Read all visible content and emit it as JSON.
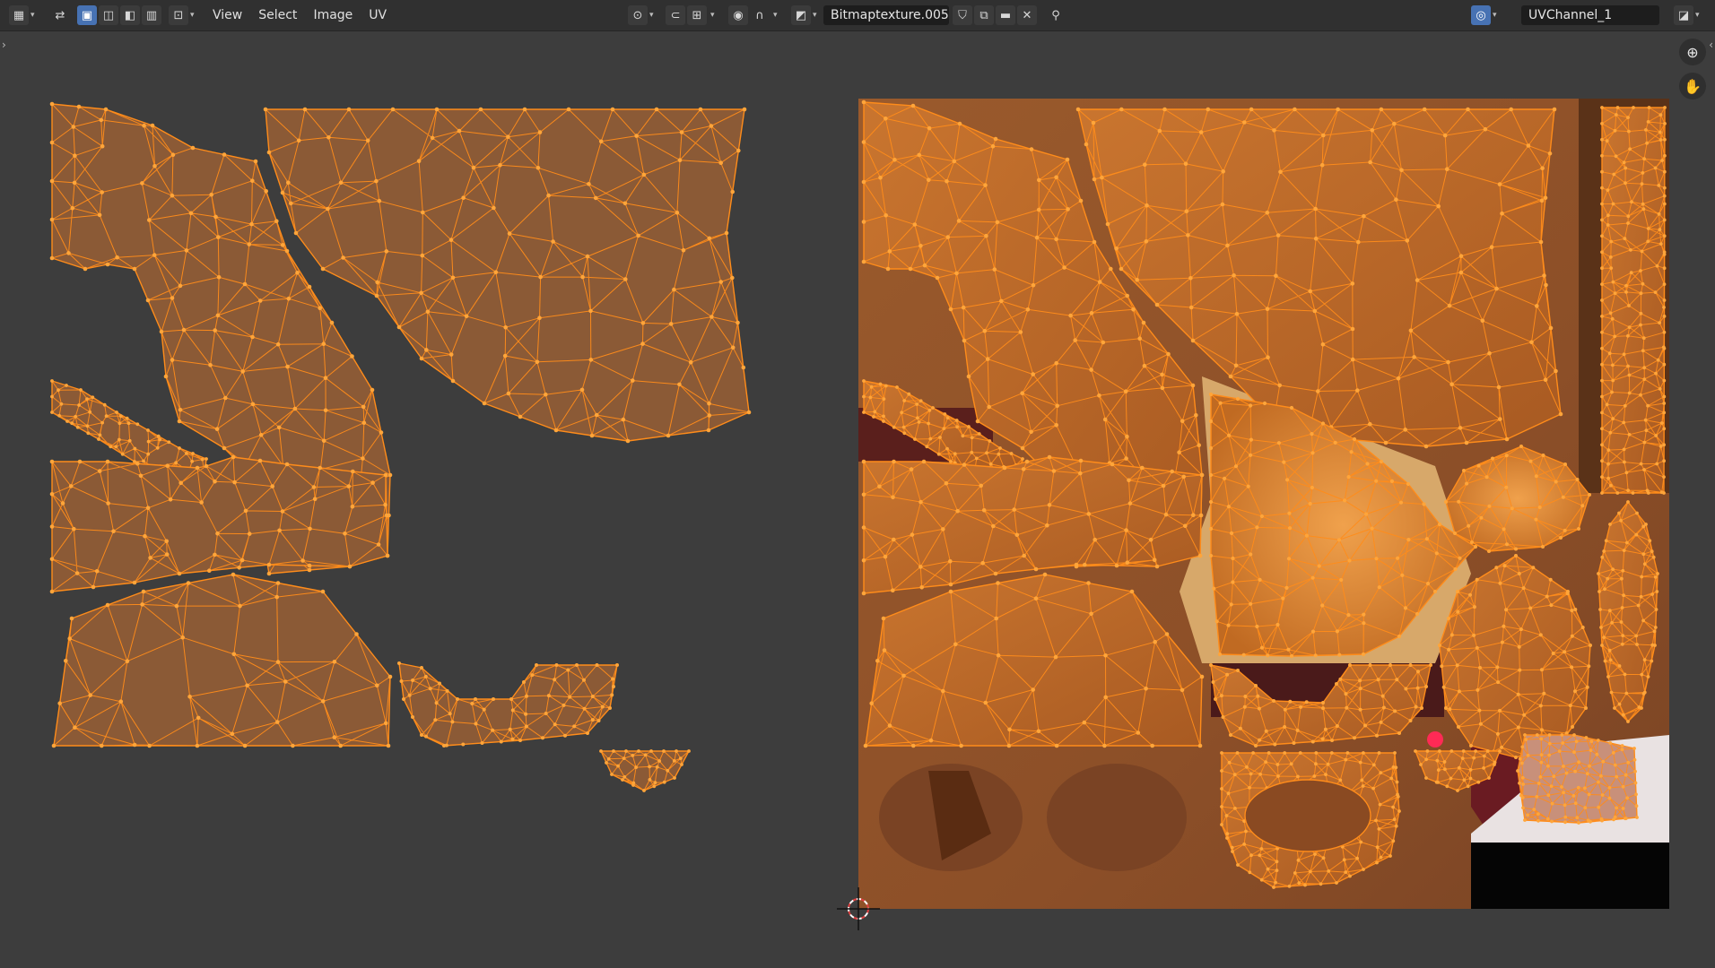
{
  "header": {
    "menus": [
      "View",
      "Select",
      "Image",
      "UV"
    ],
    "image_name": "Bitmaptexture.005",
    "uv_map": "UVChannel_1",
    "icons": [
      "editor-type-icon",
      "uv-sync-icon",
      "vertex-select-icon",
      "edge-select-icon",
      "face-select-icon",
      "island-select-icon",
      "sticky-select-icon",
      "pivot-icon",
      "snap-icon",
      "snap-target-icon",
      "proportional-icon",
      "falloff-icon",
      "image-browse-icon",
      "fake-user-icon",
      "new-image-icon",
      "open-image-icon",
      "unlink-image-icon",
      "pin-icon",
      "render-slot-icon",
      "display-channel-icon"
    ]
  },
  "viewport": {
    "gizmos": [
      "zoom-icon",
      "pan-hand-icon"
    ],
    "colors": {
      "background": "#3d3d3d",
      "uv_fill": "#8b5a36",
      "uv_edge": "#ff8c1a",
      "uv_vertex": "#ffa53a",
      "texture_base": "#8f5530"
    }
  }
}
